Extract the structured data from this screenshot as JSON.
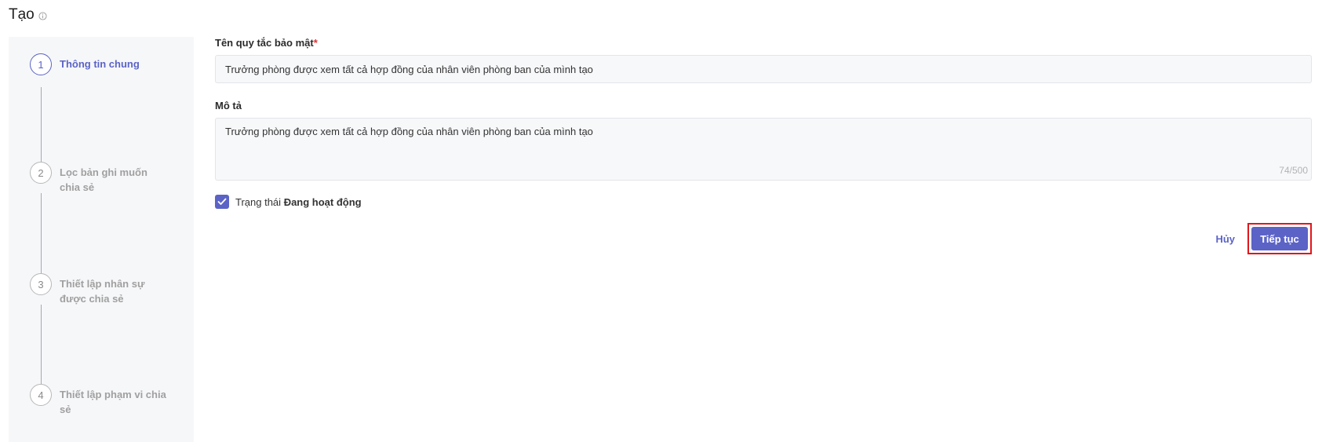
{
  "page": {
    "title": "Tạo",
    "info_icon": "info-circle-icon"
  },
  "stepper": {
    "steps": [
      {
        "number": "1",
        "label": "Thông tin chung",
        "active": true
      },
      {
        "number": "2",
        "label": "Lọc bản ghi muốn chia sẻ",
        "active": false
      },
      {
        "number": "3",
        "label": "Thiết lập nhân sự được chia sẻ",
        "active": false
      },
      {
        "number": "4",
        "label": "Thiết lập phạm vi chia sẻ",
        "active": false
      }
    ]
  },
  "form": {
    "name_label": "Tên quy tắc bảo mật",
    "required_mark": "*",
    "name_value": "Trưởng phòng được xem tất cả hợp đồng của nhân viên phòng ban của mình tạo",
    "description_label": "Mô tả",
    "description_value": "Trưởng phòng được xem tất cả hợp đồng của nhân viên phòng ban của mình tạo",
    "char_count": "74/500",
    "status_label": "Trạng thái",
    "status_value": "Đang hoạt động",
    "status_checked": true
  },
  "actions": {
    "cancel_label": "Hủy",
    "next_label": "Tiếp tục"
  },
  "colors": {
    "accent": "#5b63c6",
    "highlight_border": "#e0161c"
  }
}
